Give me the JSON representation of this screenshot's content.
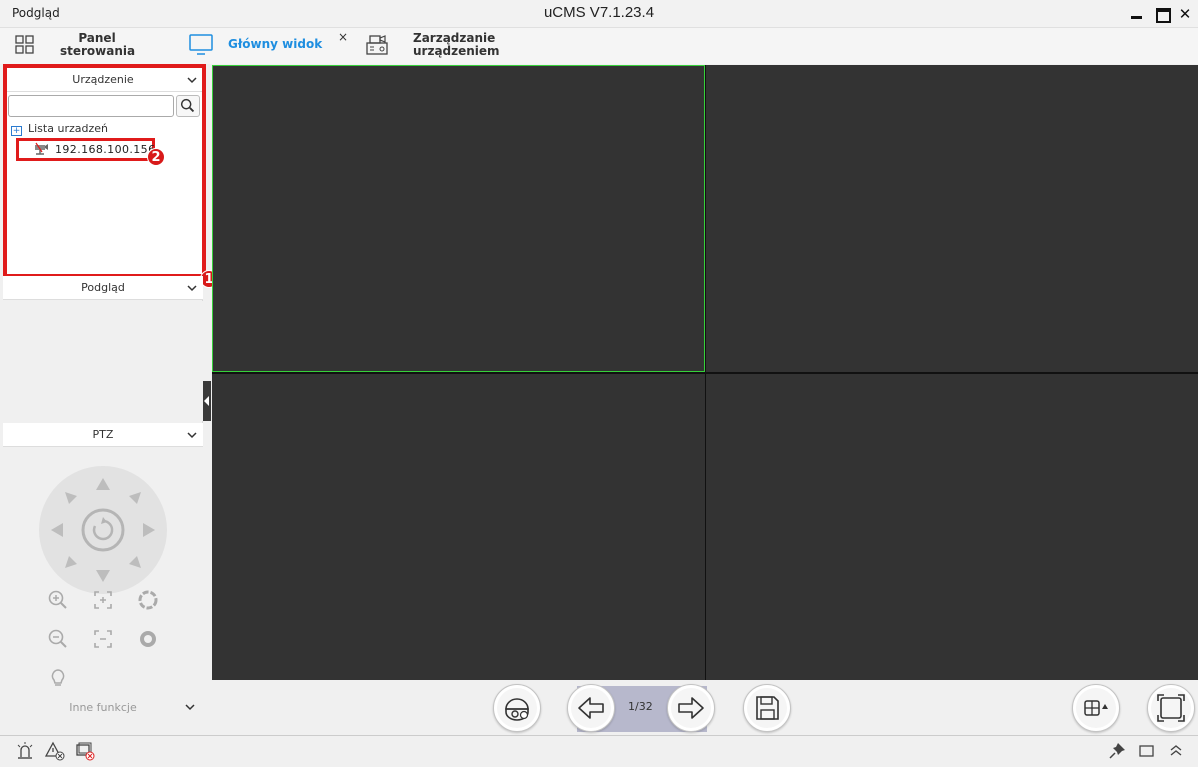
{
  "window": {
    "left_title": "Podgląd",
    "app_title": "uCMS V7.1.23.4",
    "close_glyph": "✕"
  },
  "tabs": {
    "panel_line1": "Panel",
    "panel_line2": "sterowania",
    "main_label": "Główny widok",
    "main_close": "×",
    "device_line1": "Zarządzanie",
    "device_line2": "urządzeniem"
  },
  "sidebar": {
    "device_header": "Urządzenie",
    "search_placeholder": "",
    "tree_root_label": "Lista urzadzeń",
    "tree_item_ip": "192.168.100.156",
    "badge_1": "1",
    "badge_2": "2",
    "preview_header": "Podgląd",
    "ptz_header": "PTZ",
    "more_functions": "Inne funkcje"
  },
  "bottom": {
    "page_indicator": "1/32"
  },
  "colors": {
    "accent": "#1e8ee0",
    "highlight": "#e01b1b",
    "selected_cell": "#36d13a"
  },
  "icons": [
    "grid-icon",
    "monitor-icon",
    "device-manage-icon",
    "search-icon",
    "chevron-down-icon",
    "camera-icon",
    "zoom-in-icon",
    "zoom-out-icon",
    "focus-in-icon",
    "focus-out-icon",
    "iris-open-icon",
    "iris-close-icon",
    "light-icon",
    "ptz-camera-icon",
    "arrow-left-icon",
    "arrow-right-icon",
    "save-icon",
    "layout-icon",
    "fullscreen-icon",
    "alarm-icon",
    "alert-icon",
    "image-alert-icon",
    "pin-icon",
    "window-icon",
    "collapse-up-icon"
  ]
}
